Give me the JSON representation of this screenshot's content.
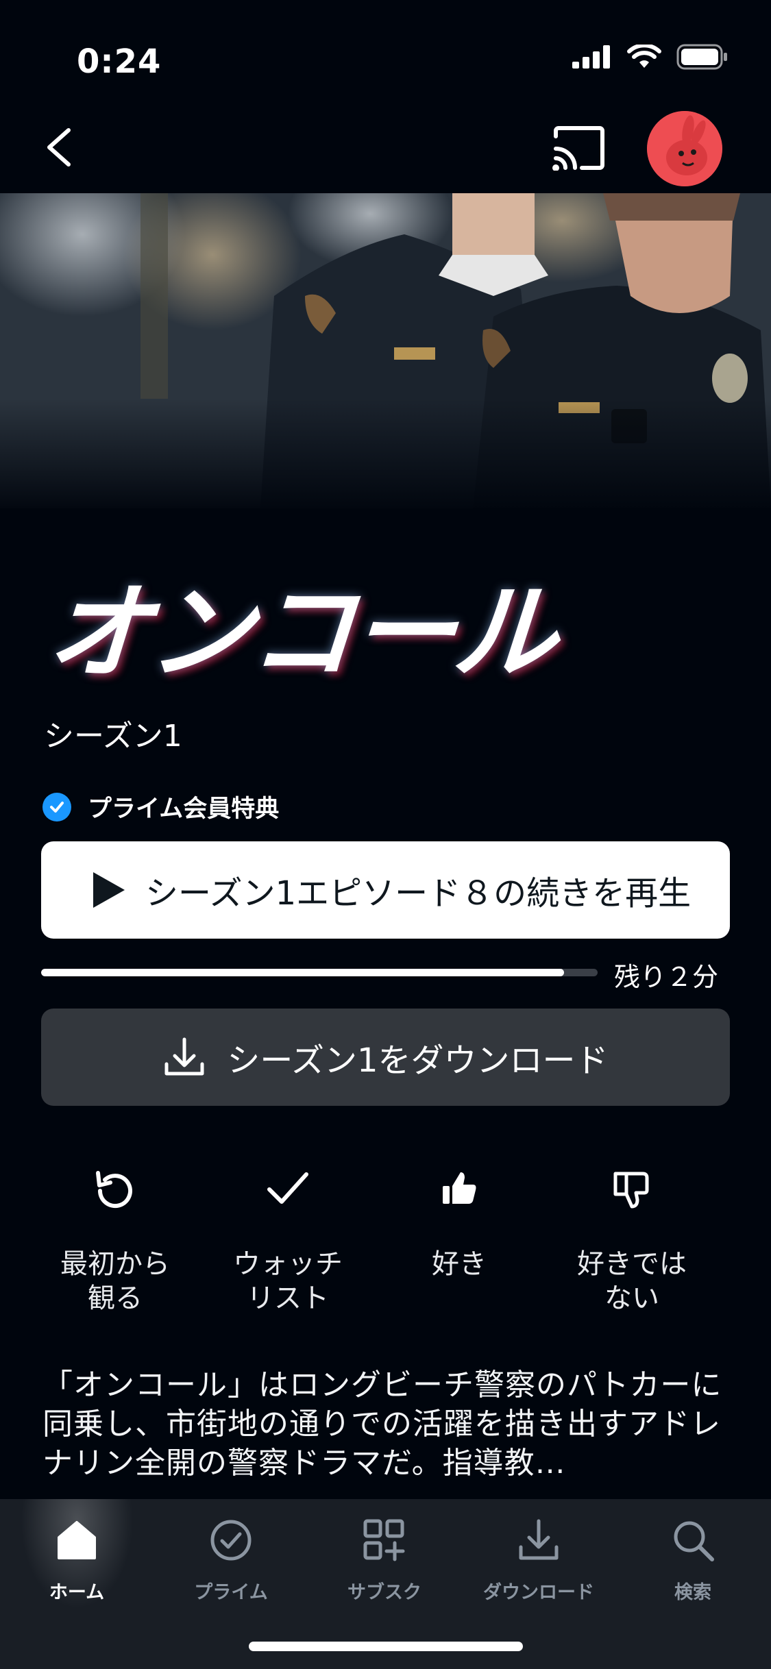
{
  "status_bar": {
    "time": "0:24"
  },
  "show": {
    "title": "オンコール",
    "season_label": "シーズン1",
    "prime_badge": "プライム会員特典"
  },
  "play_button": {
    "label": "シーズン1エピソード８の続きを再生"
  },
  "progress": {
    "remaining": "残り２分",
    "fraction_watched": 0.94
  },
  "download_button": {
    "label": "シーズン1をダウンロード"
  },
  "actions": [
    {
      "label": "最初から\n観る",
      "icon": "restart-icon"
    },
    {
      "label": "ウォッチ\nリスト",
      "icon": "checkmark-icon"
    },
    {
      "label": "好き",
      "icon": "thumbs-up-icon"
    },
    {
      "label": "好きではない",
      "label_display": "好きでは\nない",
      "icon": "thumbs-down-icon"
    }
  ],
  "description": "「オンコール」はロングビーチ警察のパトカーに同乗し、市街地の通りでの活躍を描き出すアドレナリン全開の警察ドラマだ。指導教…",
  "bottom_nav": [
    {
      "label": "ホーム",
      "icon": "home-icon",
      "active": true
    },
    {
      "label": "プライム",
      "icon": "prime-check-icon",
      "active": false
    },
    {
      "label": "サブスク",
      "icon": "subscriptions-grid-icon",
      "active": false
    },
    {
      "label": "ダウンロード",
      "icon": "download-icon",
      "active": false
    },
    {
      "label": "検索",
      "icon": "search-icon",
      "active": false
    }
  ],
  "colors": {
    "background": "#00050d",
    "accent": "#1a98ff",
    "avatar": "#ee4d52",
    "nav_bg": "#191e25"
  }
}
